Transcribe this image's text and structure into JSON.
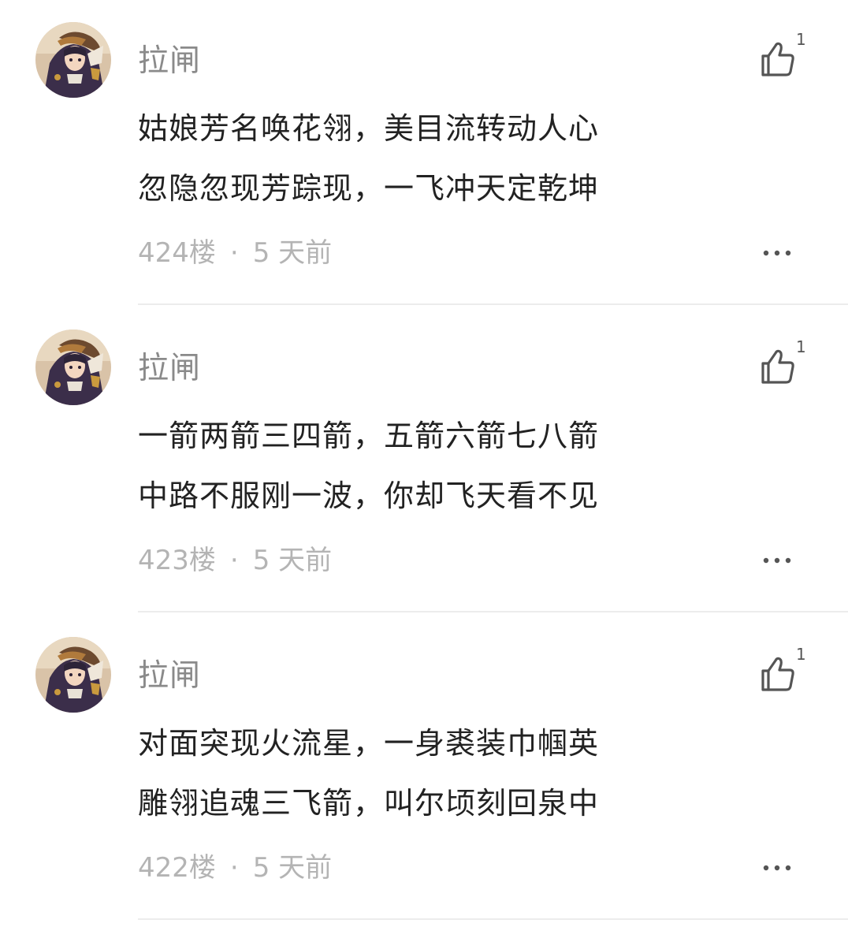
{
  "comments": [
    {
      "user": "拉闸",
      "likes": "1",
      "lines": [
        "姑娘芳名唤花翎，美目流转动人心",
        "忽隐忽现芳踪现，一飞冲天定乾坤"
      ],
      "floor": "424楼",
      "separator": "·",
      "time": "5 天前"
    },
    {
      "user": "拉闸",
      "likes": "1",
      "lines": [
        "一箭两箭三四箭，五箭六箭七八箭",
        "中路不服刚一波，你却飞天看不见"
      ],
      "floor": "423楼",
      "separator": "·",
      "time": "5 天前"
    },
    {
      "user": "拉闸",
      "likes": "1",
      "lines": [
        "对面突现火流星，一身裘装巾帼英",
        "雕翎追魂三飞箭，叫尔顷刻回泉中"
      ],
      "floor": "422楼",
      "separator": "·",
      "time": "5 天前"
    }
  ],
  "icons": {
    "like": "thumbs-up-icon",
    "more": "more-dots-icon",
    "avatar": "avatar-image"
  },
  "colors": {
    "username": "#8a8a8a",
    "body_text": "#222222",
    "meta_text": "#b4b4b4",
    "icon": "#555555",
    "divider": "#ececec"
  }
}
